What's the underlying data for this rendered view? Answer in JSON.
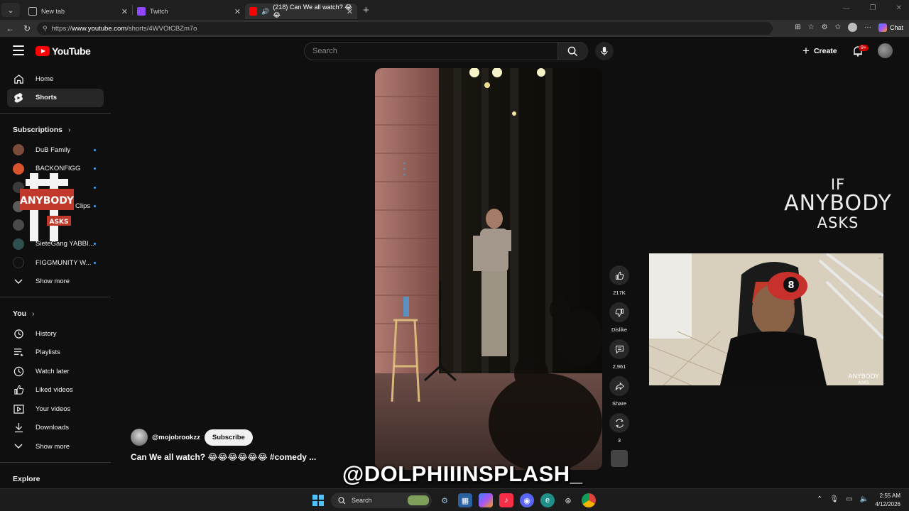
{
  "browser": {
    "tabs": [
      {
        "title": "New tab",
        "active": false
      },
      {
        "title": "Twitch",
        "active": false
      },
      {
        "title": "(218) Can We all watch? 😂😂",
        "active": true
      }
    ],
    "url": {
      "prefix": "https://",
      "host": "www.youtube.com",
      "path": "/shorts/4WVOtCBZm7o"
    },
    "chat_label": "Chat"
  },
  "header": {
    "logo_text": "YouTube",
    "search_placeholder": "Search",
    "create_label": "Create",
    "notif_badge": "9+"
  },
  "sidebar": {
    "main": [
      {
        "label": "Home",
        "icon": "home-icon"
      },
      {
        "label": "Shorts",
        "icon": "shorts-icon",
        "selected": true
      }
    ],
    "subs_heading": "Subscriptions",
    "subscriptions": [
      {
        "label": "DuB Family",
        "color": "#7a4a3a"
      },
      {
        "label": "BACKONFIGG",
        "color": "#d9542b"
      },
      {
        "label": "",
        "color": "#3a3a3a"
      },
      {
        "label": "Clips",
        "color": "#5a5a5a"
      },
      {
        "label": "",
        "color": "#4a4a4a"
      },
      {
        "label": "SieteGang YABBI...",
        "color": "#2f4f4f"
      },
      {
        "label": "FIGGMUNITY W...",
        "color": "#111111"
      }
    ],
    "subs_more": "Show more",
    "you_heading": "You",
    "you_items": [
      {
        "label": "History",
        "icon": "history-icon"
      },
      {
        "label": "Playlists",
        "icon": "playlists-icon"
      },
      {
        "label": "Watch later",
        "icon": "watch-later-icon"
      },
      {
        "label": "Liked videos",
        "icon": "like-icon"
      },
      {
        "label": "Your videos",
        "icon": "your-videos-icon"
      },
      {
        "label": "Downloads",
        "icon": "download-icon"
      }
    ],
    "you_more": "Show more",
    "explore_heading": "Explore"
  },
  "short": {
    "channel": "@mojobrookzz",
    "subscribe_label": "Subscribe",
    "title": "Can We all watch? 😂😂😂😂😂😂 #comedy ...",
    "likes": "217K",
    "dislike_label": "Dislike",
    "comments": "2,961",
    "share_label": "Share",
    "remix_count": "3"
  },
  "overlay": {
    "if_l1": "IF",
    "if_l2": "ANYBODY",
    "if_l3": "ASKS",
    "small_l1": "ANYBODY",
    "small_l2": "ASKS",
    "watermark": "@DOLPHIIINSPLASH_"
  },
  "taskbar": {
    "search_label": "Search",
    "time": "2:55 AM",
    "date": "4/12/2026"
  }
}
